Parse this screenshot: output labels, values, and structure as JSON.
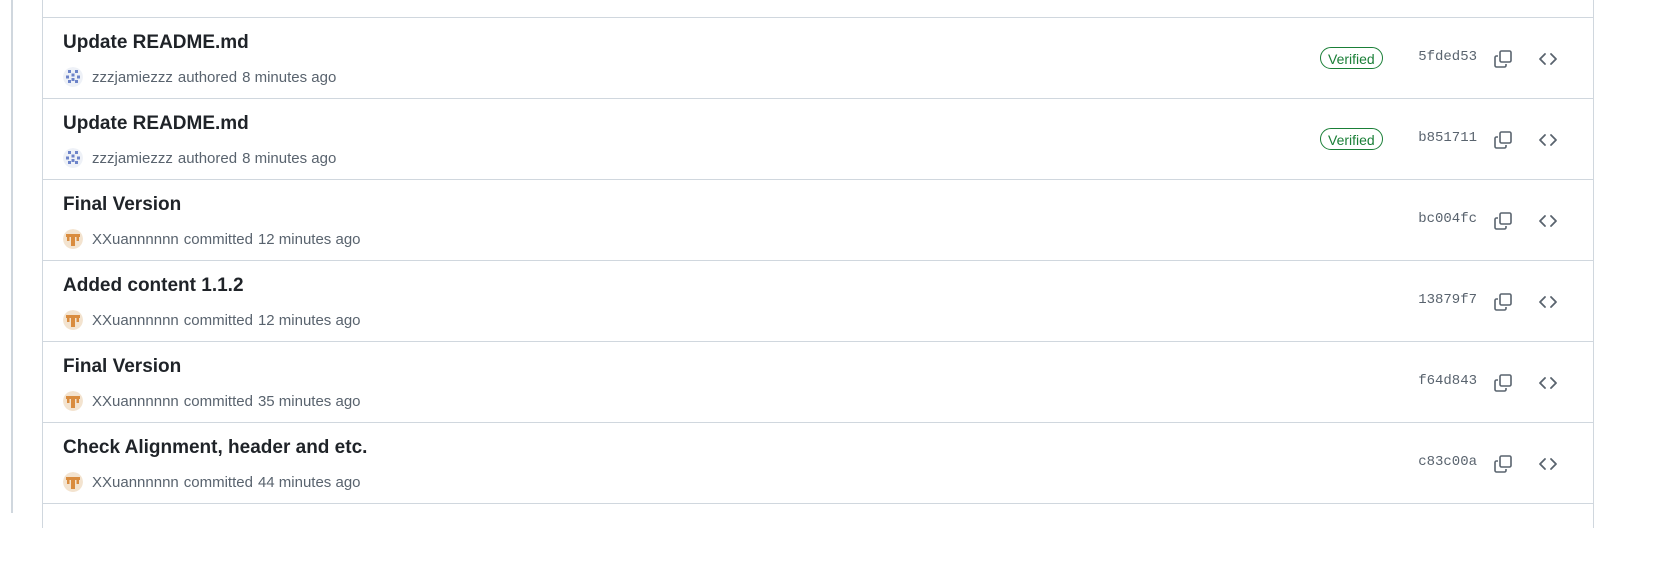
{
  "commits": [
    {
      "title": "Update README.md",
      "author": "zzzjamiezzz",
      "action": "authored",
      "time": "8 minutes ago",
      "verified": "Verified",
      "sha": "5fded53",
      "avatar": "identicon"
    },
    {
      "title": "Update README.md",
      "author": "zzzjamiezzz",
      "action": "authored",
      "time": "8 minutes ago",
      "verified": "Verified",
      "sha": "b851711",
      "avatar": "identicon"
    },
    {
      "title": "Final Version",
      "author": "XXuannnnnn",
      "action": "committed",
      "time": "12 minutes ago",
      "sha": "bc004fc",
      "avatar": "orange"
    },
    {
      "title": "Added content 1.1.2",
      "author": "XXuannnnnn",
      "action": "committed",
      "time": "12 minutes ago",
      "sha": "13879f7",
      "avatar": "orange"
    },
    {
      "title": "Final Version",
      "author": "XXuannnnnn",
      "action": "committed",
      "time": "35 minutes ago",
      "sha": "f64d843",
      "avatar": "orange"
    },
    {
      "title": "Check Alignment, header and etc.",
      "author": "XXuannnnnn",
      "action": "committed",
      "time": "44 minutes ago",
      "sha": "c83c00a",
      "avatar": "orange"
    }
  ],
  "icons": {
    "copy": "copy-icon",
    "browse": "code-icon"
  },
  "colors": {
    "verified": "#1a7f37",
    "border": "#d0d7de",
    "muted": "#59636e"
  }
}
